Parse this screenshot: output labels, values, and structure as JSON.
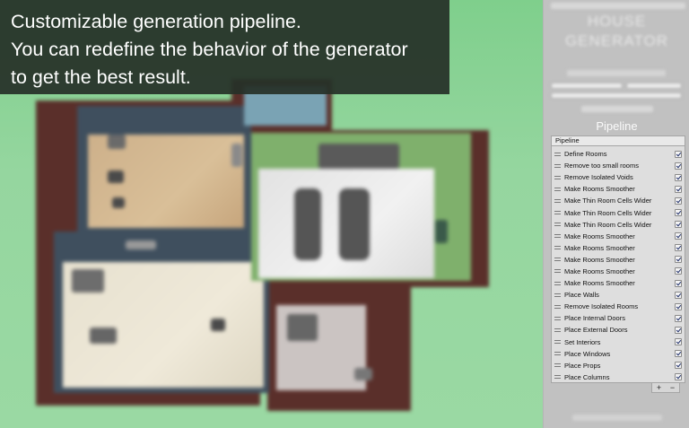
{
  "caption": {
    "lines": [
      "Customizable generation pipeline.",
      "You can redefine the behavior of the generator",
      "to get the best result."
    ]
  },
  "inspector": {
    "title_ghost_top": "HOUSE",
    "title_ghost_bottom": "GENERATOR",
    "section_heading": "Pipeline",
    "list_header": "Pipeline",
    "items": [
      {
        "label": "Define Rooms",
        "checked": true
      },
      {
        "label": "Remove too small rooms",
        "checked": true
      },
      {
        "label": "Remove Isolated Voids",
        "checked": true
      },
      {
        "label": "Make Rooms Smoother",
        "checked": true
      },
      {
        "label": "Make Thin Room Cells Wider",
        "checked": true
      },
      {
        "label": "Make Thin Room Cells Wider",
        "checked": true
      },
      {
        "label": "Make Thin Room Cells Wider",
        "checked": true
      },
      {
        "label": "Make Rooms Smoother",
        "checked": true
      },
      {
        "label": "Make Rooms Smoother",
        "checked": true
      },
      {
        "label": "Make Rooms Smoother",
        "checked": true
      },
      {
        "label": "Make Rooms Smoother",
        "checked": true
      },
      {
        "label": "Make Rooms Smoother",
        "checked": true
      },
      {
        "label": "Place Walls",
        "checked": true
      },
      {
        "label": "Remove Isolated Rooms",
        "checked": true
      },
      {
        "label": "Place Internal Doors",
        "checked": true
      },
      {
        "label": "Place External Doors",
        "checked": true
      },
      {
        "label": "Set Interiors",
        "checked": true
      },
      {
        "label": "Place Windows",
        "checked": true
      },
      {
        "label": "Place Props",
        "checked": true
      },
      {
        "label": "Place Columns",
        "checked": true
      }
    ],
    "add_label": "+",
    "remove_label": "−"
  },
  "colors": {
    "background_green": "#8fd39a",
    "caption_bg": "#263028",
    "panel_bg": "#c1c1c1"
  }
}
